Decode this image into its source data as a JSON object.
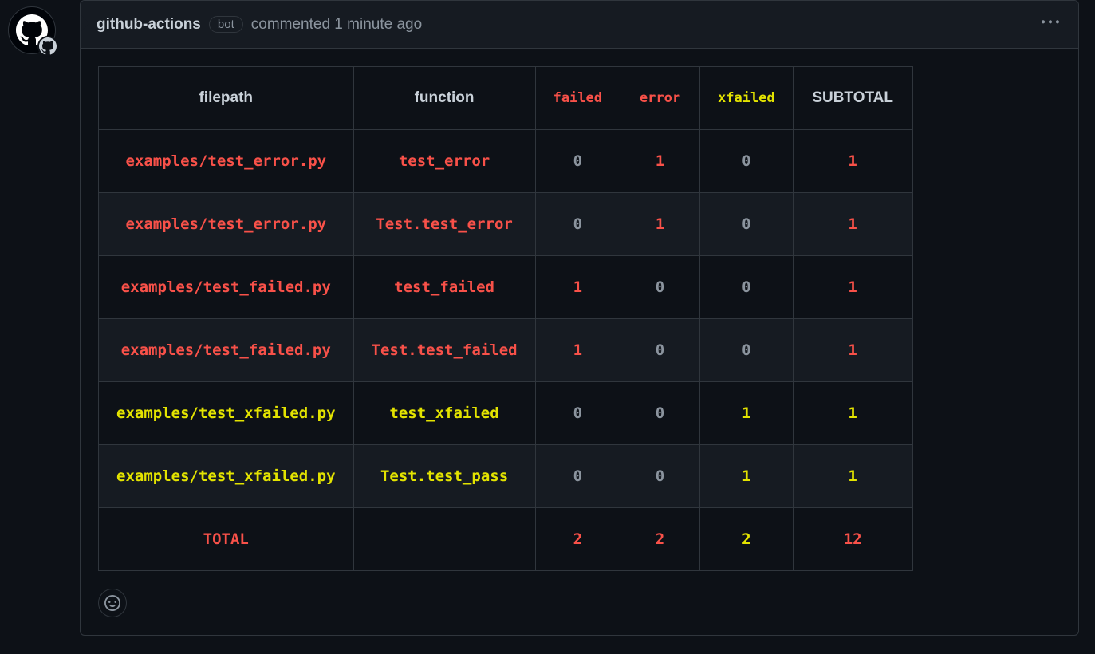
{
  "comment": {
    "author": "github-actions",
    "bot_badge": "bot",
    "action_text": "commented 1 minute ago"
  },
  "table": {
    "headers": {
      "filepath": "filepath",
      "function": "function",
      "failed": "failed",
      "error": "error",
      "xfailed": "xfailed",
      "subtotal": "SUBTOTAL"
    },
    "rows": [
      {
        "filepath": "examples/test_error.py",
        "function": "test_error",
        "failed": "0",
        "error": "1",
        "xfailed": "0",
        "subtotal": "1",
        "path_class": "red",
        "fn_class": "red",
        "failed_class": "muted",
        "error_class": "red",
        "xfailed_class": "muted",
        "subtotal_class": "red"
      },
      {
        "filepath": "examples/test_error.py",
        "function": "Test.test_error",
        "failed": "0",
        "error": "1",
        "xfailed": "0",
        "subtotal": "1",
        "path_class": "red",
        "fn_class": "red",
        "failed_class": "muted",
        "error_class": "red",
        "xfailed_class": "muted",
        "subtotal_class": "red"
      },
      {
        "filepath": "examples/test_failed.py",
        "function": "test_failed",
        "failed": "1",
        "error": "0",
        "xfailed": "0",
        "subtotal": "1",
        "path_class": "red",
        "fn_class": "red",
        "failed_class": "red",
        "error_class": "muted",
        "xfailed_class": "muted",
        "subtotal_class": "red"
      },
      {
        "filepath": "examples/test_failed.py",
        "function": "Test.test_failed",
        "failed": "1",
        "error": "0",
        "xfailed": "0",
        "subtotal": "1",
        "path_class": "red",
        "fn_class": "red",
        "failed_class": "red",
        "error_class": "muted",
        "xfailed_class": "muted",
        "subtotal_class": "red"
      },
      {
        "filepath": "examples/test_xfailed.py",
        "function": "test_xfailed",
        "failed": "0",
        "error": "0",
        "xfailed": "1",
        "subtotal": "1",
        "path_class": "yellow",
        "fn_class": "yellow",
        "failed_class": "muted",
        "error_class": "muted",
        "xfailed_class": "yellow",
        "subtotal_class": "yellow"
      },
      {
        "filepath": "examples/test_xfailed.py",
        "function": "Test.test_pass",
        "failed": "0",
        "error": "0",
        "xfailed": "1",
        "subtotal": "1",
        "path_class": "yellow",
        "fn_class": "yellow",
        "failed_class": "muted",
        "error_class": "muted",
        "xfailed_class": "yellow",
        "subtotal_class": "yellow"
      }
    ],
    "total_row": {
      "label": "TOTAL",
      "function": "",
      "failed": "2",
      "error": "2",
      "xfailed": "2",
      "subtotal": "12"
    }
  }
}
